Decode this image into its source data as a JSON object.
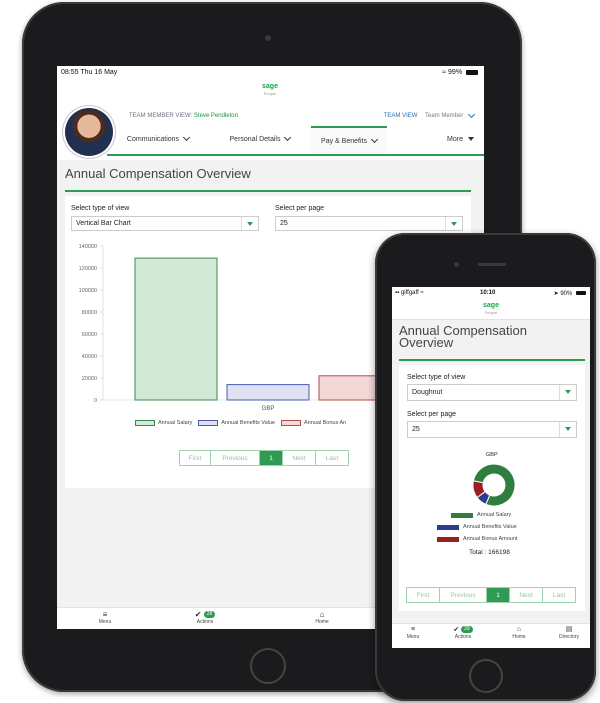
{
  "tablet": {
    "status": {
      "time": "08:55  Thu 16 May",
      "battery": "99%"
    },
    "brand": {
      "name": "sage",
      "sub": "People"
    },
    "profile": {
      "team_member_label": "TEAM MEMBER VIEW:",
      "team_member_name": "Steve Pendleton",
      "team_view": "TEAM VIEW",
      "team_member": "Team Member"
    },
    "nav": [
      "Communications",
      "Personal Details",
      "Pay & Benefits",
      "More"
    ],
    "page_title": "Annual Compensation Overview",
    "view_label": "Select type of view",
    "view_value": "Vertical Bar Chart",
    "per_page_label": "Select per page",
    "per_page_value": "25",
    "pager": [
      "First",
      "Previous",
      "1",
      "Next",
      "Last"
    ],
    "tabs": {
      "menu": "Menu",
      "actions": "Actions",
      "actions_badge": "28",
      "home": "Home"
    }
  },
  "chart_data": {
    "type": "bar",
    "categories": [
      "GBP"
    ],
    "series": [
      {
        "name": "Annual Salary",
        "values": [
          129000
        ],
        "fill": "#d3e9d8",
        "stroke": "#3b8a4f"
      },
      {
        "name": "Annual Benefits Value",
        "values": [
          14000
        ],
        "fill": "#dfe1f3",
        "stroke": "#4a5bb0"
      },
      {
        "name": "Annual Bonus Amount",
        "values": [
          22000
        ],
        "fill": "#f3d8d8",
        "stroke": "#b24b4b"
      }
    ],
    "xlabel": "GBP",
    "ylim": [
      0,
      140000
    ],
    "yticks": [
      "140000",
      "120000",
      "100000",
      "80000",
      "60000",
      "40000",
      "20000",
      "0"
    ],
    "legend_labels": [
      "Annual Salary",
      "Annual Benefits Value",
      "Annual Bonus An"
    ],
    "grid": false,
    "legend": "bottom"
  },
  "phone": {
    "status": {
      "carrier": "giffgaff",
      "time": "10:10",
      "battery": "90%"
    },
    "brand": {
      "name": "sage",
      "sub": "People"
    },
    "page_title": "Annual Compensation Overview",
    "view_label": "Select type of view",
    "view_value": "Doughnut",
    "per_page_label": "Select per page",
    "per_page_value": "25",
    "donut_title": "GBP",
    "donut_values": [
      129000,
      14000,
      22000
    ],
    "donut_colors": [
      "#2f7d3f",
      "#2b3d8f",
      "#9a1f25"
    ],
    "legend": [
      "Annual Salary",
      "Annual Benefits Value",
      "Annual Bonus Amount"
    ],
    "total": "Total : 166198",
    "pager": [
      "First",
      "Previous",
      "1",
      "Next",
      "Last"
    ],
    "tabs": {
      "menu": "Menu",
      "actions": "Actions",
      "actions_badge": "29",
      "home": "Home",
      "directory": "Directory"
    }
  }
}
